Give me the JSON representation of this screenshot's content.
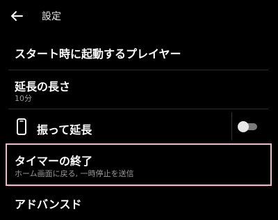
{
  "header": {
    "title": "設定",
    "back_icon": "arrow-left-icon"
  },
  "settings": [
    {
      "title": "スタート時に起動するプレイヤー"
    },
    {
      "title": "延長の長さ",
      "subtitle": "10分"
    },
    {
      "title": "振って延長",
      "icon": "phone-icon",
      "toggle": {
        "on": false
      }
    },
    {
      "title": "タイマーの終了",
      "subtitle": "ホーム画面に戻る, 一時停止を送信"
    },
    {
      "title": "アドバンスド"
    }
  ],
  "colors": {
    "background": "#000000",
    "text": "#ffffff",
    "subtext": "#9a9a9a",
    "highlight_border": "#f2b6cd"
  }
}
